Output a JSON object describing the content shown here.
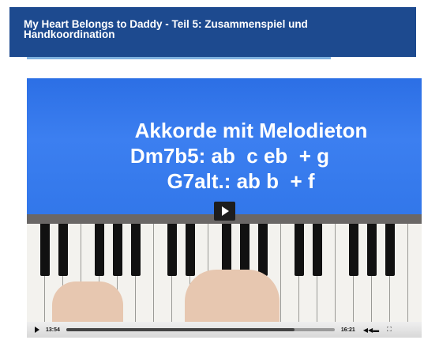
{
  "header": {
    "title": "My Heart Belongs to Daddy - Teil 5: Zusammenspiel und Handkoordination"
  },
  "video": {
    "slide_lines": [
      "Akkorde mit Melodieton",
      "Dm7b5: ab  c eb  + g",
      "G7alt.: ab b  + f"
    ],
    "elapsed": "13:54",
    "duration": "16:21",
    "progress": 0.85,
    "play_icon": "play-icon",
    "volume_icon": "volume-icon",
    "fullscreen_icon": "fullscreen-icon"
  },
  "colors": {
    "header_bg": "#1d4a8f",
    "accent_underline": "#7fb2e0",
    "slide_blue": "#3277ea"
  }
}
